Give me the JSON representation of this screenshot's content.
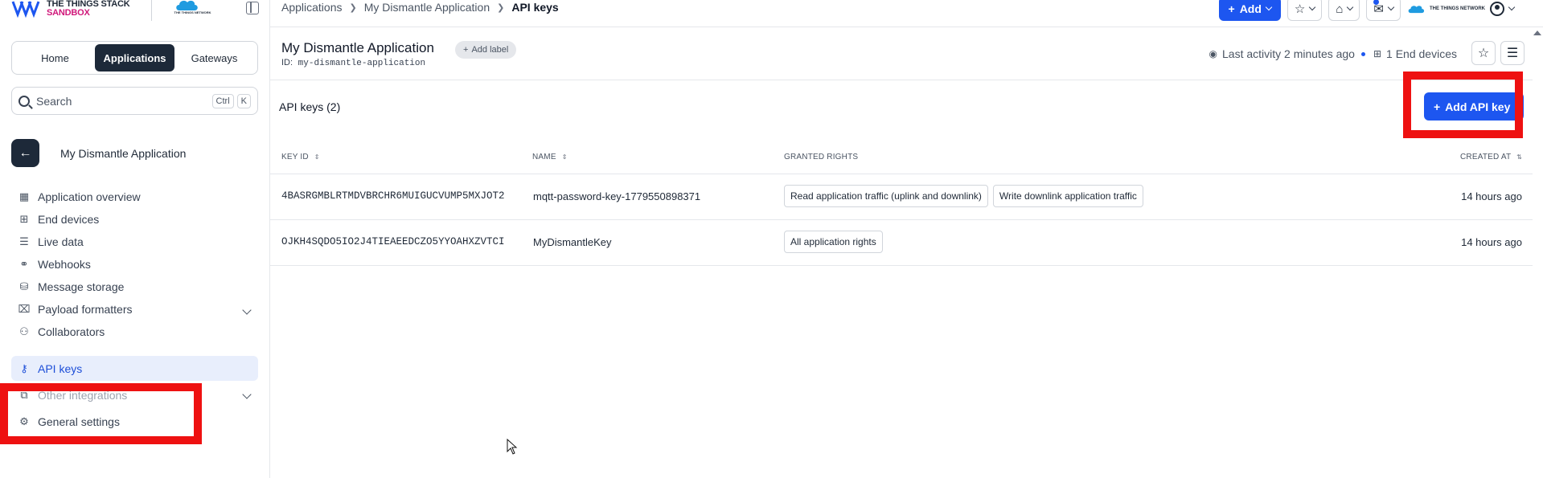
{
  "brand": {
    "line1": "THE THINGS STACK",
    "line2": "SANDBOX",
    "partner_caption": "THE THINGS NETWORK",
    "accent": "#1d56f0",
    "dark": "#1d2939",
    "highlight_box": "#ee1111"
  },
  "top_tabs": [
    {
      "label": "Home"
    },
    {
      "label": "Applications"
    },
    {
      "label": "Gateways"
    }
  ],
  "search": {
    "placeholder": "Search",
    "kbd1": "Ctrl",
    "kbd2": "K"
  },
  "app_context": {
    "name": "My Dismantle Application"
  },
  "sidebar": {
    "items": [
      {
        "label": "Application overview",
        "icon": "grid-icon"
      },
      {
        "label": "End devices",
        "icon": "chip-icon"
      },
      {
        "label": "Live data",
        "icon": "list-icon"
      },
      {
        "label": "Webhooks",
        "icon": "webhook-icon"
      },
      {
        "label": "Message storage",
        "icon": "database-icon"
      },
      {
        "label": "Payload formatters",
        "icon": "code-icon"
      },
      {
        "label": "Collaborators",
        "icon": "users-icon"
      },
      {
        "label": "API keys",
        "icon": "key-icon"
      },
      {
        "label": "Other integrations",
        "icon": "puzzle-icon"
      },
      {
        "label": "General settings",
        "icon": "gear-icon"
      }
    ]
  },
  "breadcrumb": {
    "items": [
      "Applications",
      "My Dismantle Application",
      "API keys"
    ]
  },
  "topbar": {
    "add_label": "Add"
  },
  "header": {
    "title": "My Dismantle Application",
    "add_label": "Add label",
    "id_label": "ID:",
    "id_value": "my-dismantle-application",
    "last_activity": "Last activity 2 minutes ago",
    "end_devices": "1 End devices"
  },
  "main": {
    "section_title": "API keys (2)",
    "add_button": "Add API key"
  },
  "table": {
    "columns": {
      "key_id": "KEY ID",
      "name": "NAME",
      "rights": "GRANTED RIGHTS",
      "created": "CREATED AT"
    },
    "rows": [
      {
        "key_id": "4BASRGMBLRTMDVBRCHR6MUIGUCVUMP5MXJOT2",
        "name": "mqtt-password-key-1779550898371",
        "rights": [
          "Read application traffic (uplink and downlink)",
          "Write downlink application traffic"
        ],
        "created": "14 hours ago"
      },
      {
        "key_id": "OJKH4SQDO5IO2J4TIEAEEDCZO5YYOAHXZVTCI",
        "name": "MyDismantleKey",
        "rights": [
          "All application rights"
        ],
        "created": "14 hours ago"
      }
    ]
  }
}
